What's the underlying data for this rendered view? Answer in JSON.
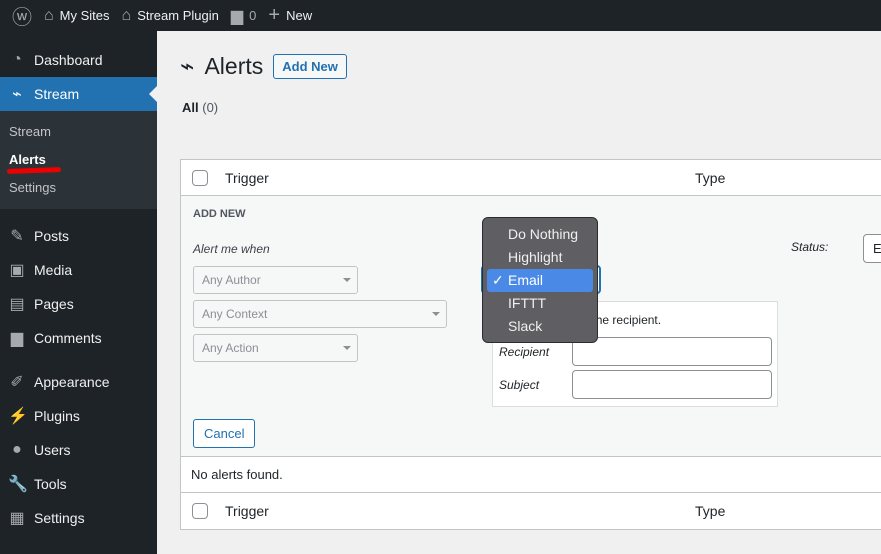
{
  "adminbar": {
    "my_sites": "My Sites",
    "site": "Stream Plugin",
    "comments": "0",
    "new": "New"
  },
  "sidebar": {
    "items": [
      {
        "label": "Dashboard",
        "icon": "dashboard-icon"
      },
      {
        "label": "Stream",
        "icon": "stream-icon"
      },
      {
        "label": "Posts",
        "icon": "pin-icon"
      },
      {
        "label": "Media",
        "icon": "media-icon"
      },
      {
        "label": "Pages",
        "icon": "pages-icon"
      },
      {
        "label": "Comments",
        "icon": "comment-icon"
      },
      {
        "label": "Appearance",
        "icon": "brush-icon"
      },
      {
        "label": "Plugins",
        "icon": "plugin-icon"
      },
      {
        "label": "Users",
        "icon": "user-icon"
      },
      {
        "label": "Tools",
        "icon": "wrench-icon"
      },
      {
        "label": "Settings",
        "icon": "settings-icon"
      }
    ],
    "submenu": [
      "Stream",
      "Alerts",
      "Settings"
    ]
  },
  "page": {
    "title": "Alerts",
    "add_new": "Add New",
    "filter_all": "All",
    "filter_count": "(0)"
  },
  "table": {
    "col_trigger": "Trigger",
    "col_type": "Type",
    "empty": "No alerts found."
  },
  "form": {
    "heading": "ADD NEW",
    "alert_me_when": "Alert me when",
    "author": "Any Author",
    "context": "Any Context",
    "action": "Any Action",
    "status_label": "Status:",
    "status_value": "Enabled",
    "email_desc": "Send an email to the recipient.",
    "recipient": "Recipient",
    "subject": "Subject",
    "cancel": "Cancel"
  },
  "dropdown": {
    "options": [
      "Do Nothing",
      "Highlight",
      "Email",
      "IFTTT",
      "Slack"
    ],
    "selected": "Email",
    "check": "✓"
  },
  "colors": {
    "accent": "#2271b1",
    "adminbar": "#1d2327",
    "menu_highlight": "#4a8ae6"
  }
}
